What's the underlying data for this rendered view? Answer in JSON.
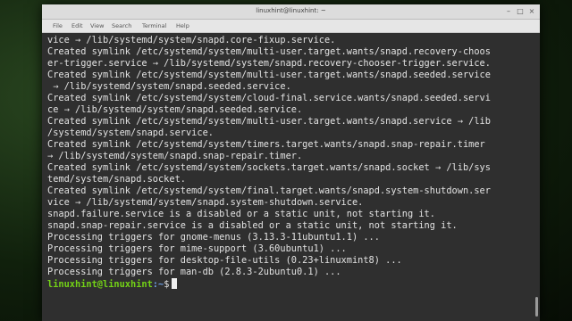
{
  "window": {
    "title": "linuxhint@linuxhint: ~",
    "controls": {
      "minimize": "–",
      "maximize": "□",
      "close": "×"
    }
  },
  "menu": [
    "File",
    "Edit",
    "View",
    "Search",
    "Terminal",
    "Help"
  ],
  "terminal": {
    "lines": [
      "vice → /lib/systemd/system/snapd.core-fixup.service.",
      "Created symlink /etc/systemd/system/multi-user.target.wants/snapd.recovery-choos",
      "er-trigger.service → /lib/systemd/system/snapd.recovery-chooser-trigger.service.",
      "Created symlink /etc/systemd/system/multi-user.target.wants/snapd.seeded.service",
      " → /lib/systemd/system/snapd.seeded.service.",
      "Created symlink /etc/systemd/system/cloud-final.service.wants/snapd.seeded.servi",
      "ce → /lib/systemd/system/snapd.seeded.service.",
      "Created symlink /etc/systemd/system/multi-user.target.wants/snapd.service → /lib",
      "/systemd/system/snapd.service.",
      "Created symlink /etc/systemd/system/timers.target.wants/snapd.snap-repair.timer",
      "→ /lib/systemd/system/snapd.snap-repair.timer.",
      "Created symlink /etc/systemd/system/sockets.target.wants/snapd.socket → /lib/sys",
      "temd/system/snapd.socket.",
      "Created symlink /etc/systemd/system/final.target.wants/snapd.system-shutdown.ser",
      "vice → /lib/systemd/system/snapd.system-shutdown.service.",
      "snapd.failure.service is a disabled or a static unit, not starting it.",
      "snapd.snap-repair.service is a disabled or a static unit, not starting it.",
      "Processing triggers for gnome-menus (3.13.3-11ubuntu1.1) ...",
      "Processing triggers for mime-support (3.60ubuntu1) ...",
      "Processing triggers for desktop-file-utils (0.23+linuxmint8) ...",
      "Processing triggers for man-db (2.8.3-2ubuntu0.1) ..."
    ],
    "prompt": {
      "user": "linuxhint@linuxhint",
      "path": ":~",
      "symbol": "$"
    }
  }
}
